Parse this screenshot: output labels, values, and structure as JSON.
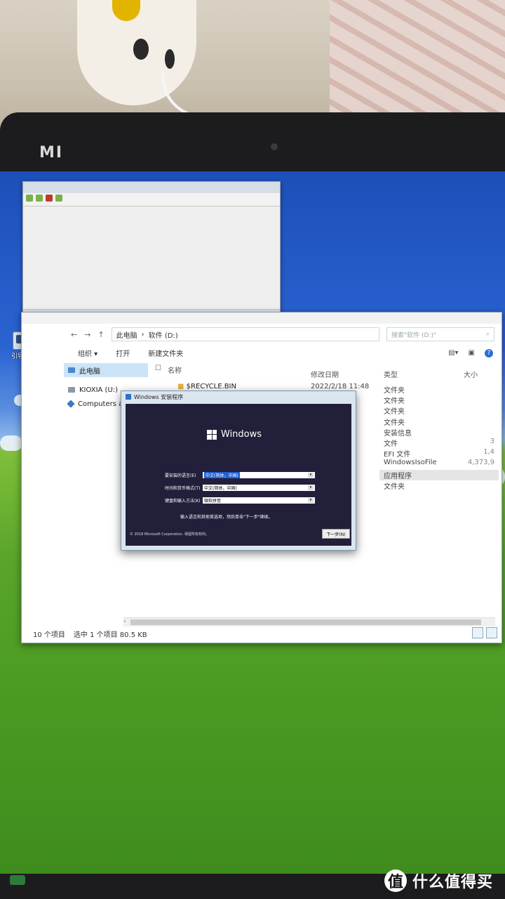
{
  "device": {
    "brand": "MI"
  },
  "desktop": {
    "icon_label": "引导设置"
  },
  "explorer": {
    "address": {
      "root": "此电脑",
      "folder": "软件 (D:)"
    },
    "search_placeholder": "搜索\"软件 (D:)\"",
    "commands": [
      "组织 ▾",
      "打开",
      "新建文件夹"
    ],
    "nav_items": [
      "此电脑",
      "KIOXIA (U:)",
      "Computers and Dev"
    ],
    "columns": {
      "name": "名称",
      "modified": "修改日期",
      "type": "类型",
      "size": "大小"
    },
    "first_row": {
      "name": "$RECYCLE.BIN",
      "date": "2022/2/18 11:48"
    },
    "types": [
      {
        "type": "文件夹",
        "size": ""
      },
      {
        "type": "文件夹",
        "size": ""
      },
      {
        "type": "文件夹",
        "size": ""
      },
      {
        "type": "文件夹",
        "size": ""
      },
      {
        "type": "安装信息",
        "size": ""
      },
      {
        "type": "文件",
        "size": "3"
      },
      {
        "type": "EFI 文件",
        "size": "1,4"
      },
      {
        "type": "WindowsIsoFile",
        "size": "4,373,9"
      },
      {
        "type": "应用程序",
        "size": ""
      },
      {
        "type": "文件夹",
        "size": ""
      }
    ],
    "status": {
      "count": "10 个项目",
      "selection": "选中 1 个项目  80.5 KB"
    }
  },
  "setup": {
    "title": "Windows 安装程序",
    "logo": "Windows",
    "fields": [
      {
        "label": "要安装的语言(E)",
        "value": "中文(简体，中国)"
      },
      {
        "label": "时间和货币格式(T)",
        "value": "中文(简体，中国)"
      },
      {
        "label": "键盘和输入方法(K)",
        "value": "微软拼音"
      }
    ],
    "hint": "输入语言和其他首选项，然后单击\"下一步\"继续。",
    "copyright": "© 2018 Microsoft Corporation. 保留所有权利。",
    "next": "下一步(N)"
  },
  "watermark": {
    "glyph": "值",
    "text": "什么值得买"
  }
}
